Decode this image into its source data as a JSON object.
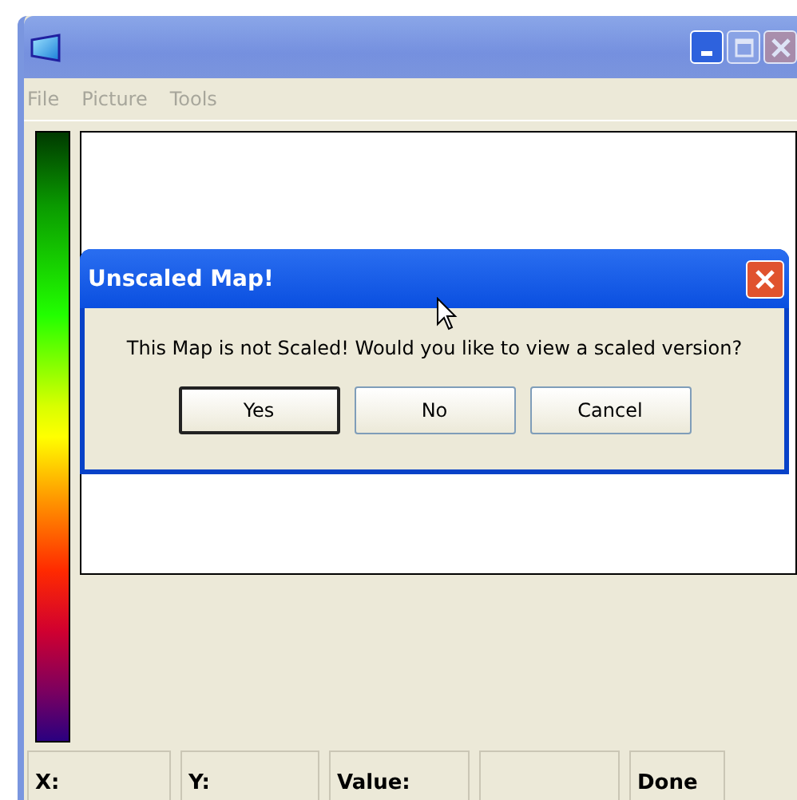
{
  "window": {
    "active": false,
    "buttons": [
      {
        "kind": "minimize",
        "disabled": false
      },
      {
        "kind": "maximize",
        "disabled": true
      },
      {
        "kind": "close",
        "disabled": true
      }
    ]
  },
  "menu": [
    {
      "label": "File",
      "disabled": true
    },
    {
      "label": "Picture",
      "disabled": true
    },
    {
      "label": "Tools",
      "disabled": true
    }
  ],
  "dialog": {
    "title": "Unscaled Map!",
    "message": "This Map is not Scaled! Would you like to view a scaled version?",
    "buttons": [
      {
        "label": "Yes",
        "selected": true
      },
      {
        "label": "No",
        "selected": false
      },
      {
        "label": "Cancel",
        "selected": false
      }
    ]
  },
  "status_bar": [
    {
      "kind": "text",
      "text": "X:"
    },
    {
      "kind": "text",
      "text": "Y:"
    },
    {
      "kind": "text",
      "text": "Value:"
    },
    {
      "kind": "empty"
    },
    {
      "kind": "text",
      "text": "Done"
    }
  ]
}
